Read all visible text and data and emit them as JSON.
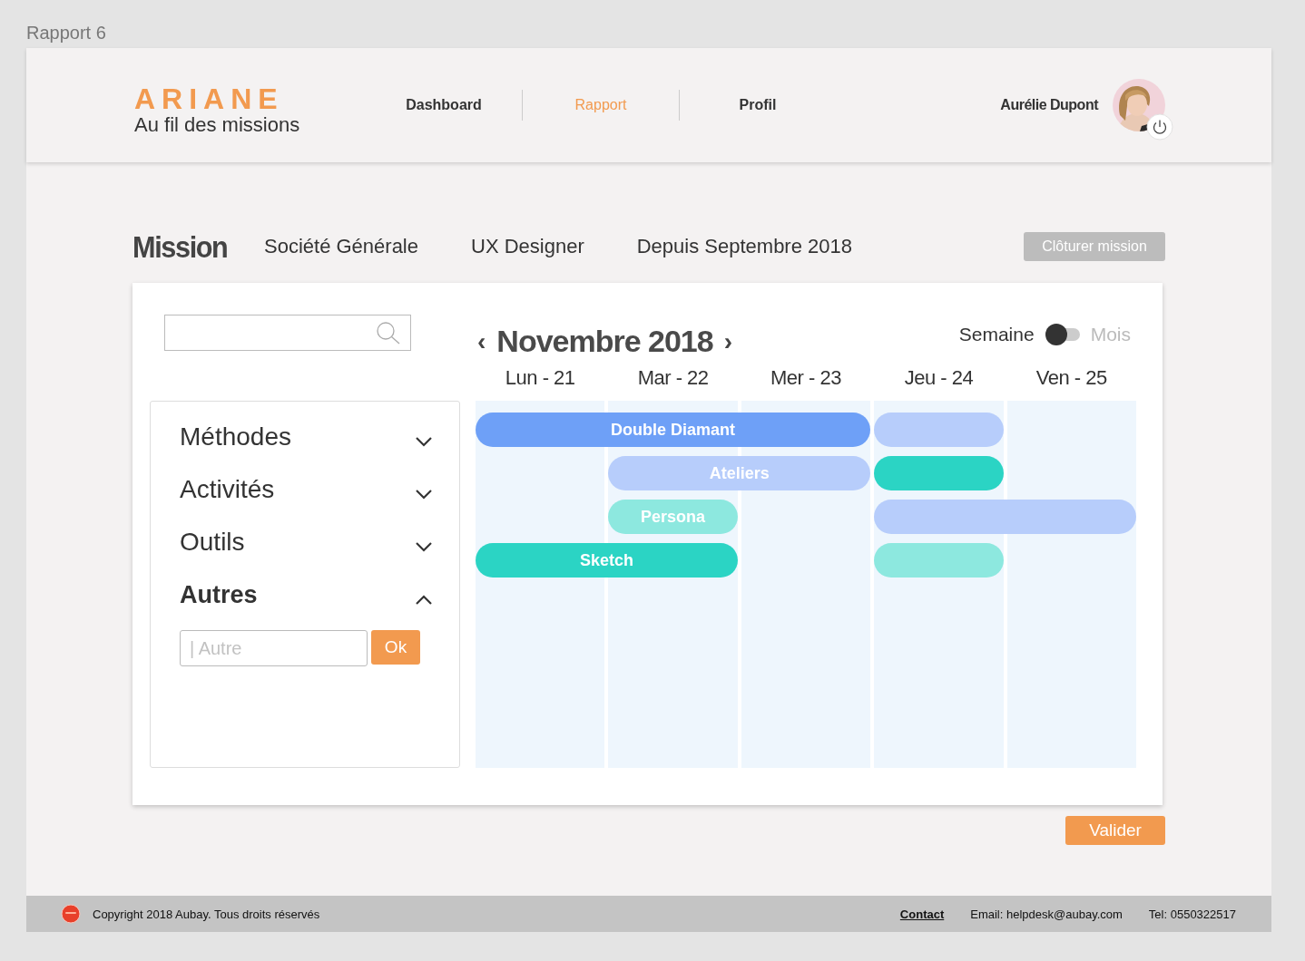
{
  "page_title": "Rapport 6",
  "brand": {
    "name": "ARIANE",
    "tagline": "Au fil des missions"
  },
  "nav": [
    {
      "label": "Dashboard",
      "selected": false
    },
    {
      "label": "Rapport",
      "selected": true
    },
    {
      "label": "Profil",
      "selected": false
    }
  ],
  "user": {
    "name": "Aurélie Dupont"
  },
  "mission": {
    "title": "Mission",
    "client": "Société Générale",
    "role": "UX Designer",
    "since": "Depuis Septembre 2018",
    "close_button": "Clôturer mission"
  },
  "sidebar": {
    "sections": [
      {
        "label": "Méthodes",
        "expanded": false
      },
      {
        "label": "Activités",
        "expanded": false
      },
      {
        "label": "Outils",
        "expanded": false
      },
      {
        "label": "Autres",
        "expanded": true,
        "field": {
          "placeholder": "| Autre"
        },
        "button": "Ok"
      }
    ]
  },
  "calendar": {
    "month": "Novembre 2018",
    "prev": "‹",
    "next": "›",
    "view_toggle": [
      {
        "label": "Semaine",
        "selected": true
      },
      {
        "label": "Mois",
        "selected": false
      }
    ],
    "days": [
      "Lun - 21",
      "Mar - 22",
      "Mer - 23",
      "Jeu - 24",
      "Ven - 25"
    ],
    "lanes": [
      {
        "slots": [
          {
            "kind": "event",
            "label": "Double Diamant",
            "color": "#6ea0f7"
          },
          {
            "kind": "continued"
          },
          {
            "kind": "continued"
          },
          {
            "kind": "event",
            "color": "#b7cdfb"
          },
          {
            "kind": "empty"
          }
        ]
      },
      {
        "slots": [
          {
            "kind": "empty"
          },
          {
            "kind": "event",
            "label": "Ateliers",
            "color": "#b7cdfb"
          },
          {
            "kind": "continued"
          },
          {
            "kind": "event",
            "color": "#2bd4c4"
          },
          {
            "kind": "empty"
          }
        ]
      },
      {
        "slots": [
          {
            "kind": "empty"
          },
          {
            "kind": "event",
            "label": "Persona",
            "color": "#8de8df"
          },
          {
            "kind": "empty"
          },
          {
            "kind": "event",
            "color": "#b7cdfb"
          },
          {
            "kind": "continued"
          }
        ]
      },
      {
        "slots": [
          {
            "kind": "event",
            "label": "Sketch",
            "color": "#2bd4c4"
          },
          {
            "kind": "continued"
          },
          {
            "kind": "empty"
          },
          {
            "kind": "event",
            "color": "#8de8df"
          },
          {
            "kind": "empty"
          }
        ]
      }
    ]
  },
  "submit_button": "Valider",
  "footer": {
    "copyright": "Copyright 2018 Aubay. Tous droits réservés",
    "contact": "Contact",
    "email": "Email: helpdesk@aubay.com",
    "phone": "Tel: 0550322517"
  }
}
